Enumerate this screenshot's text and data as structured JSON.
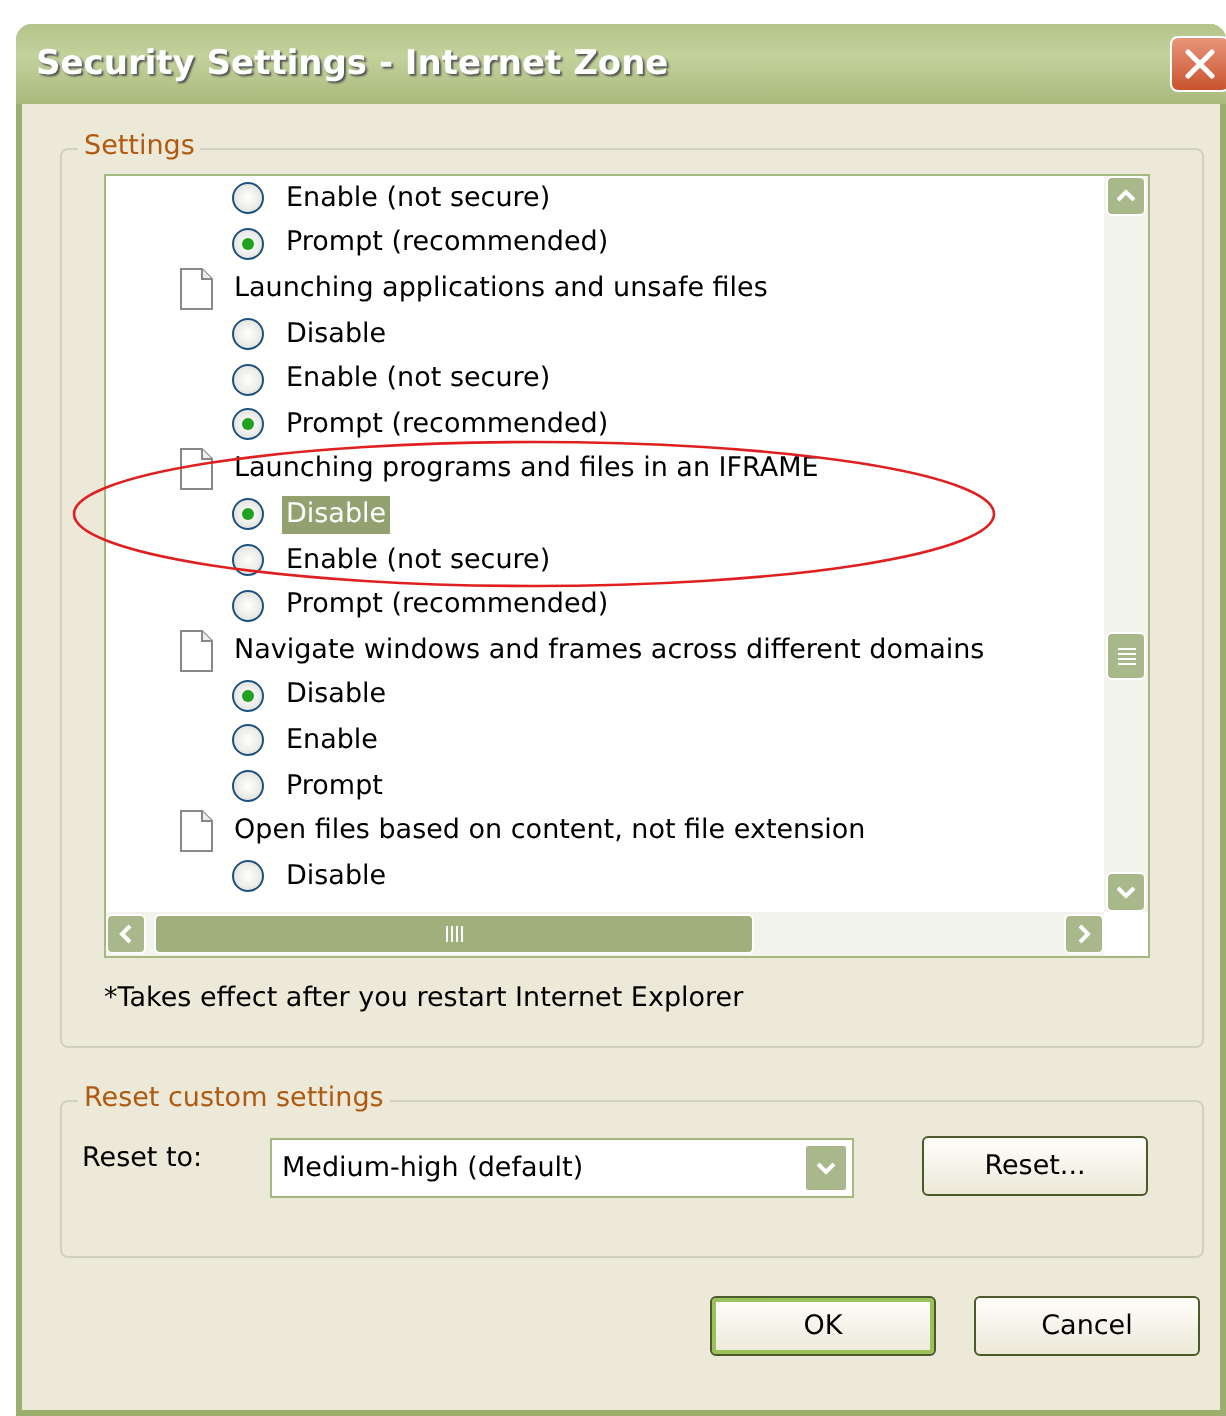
{
  "window": {
    "title": "Security Settings - Internet Zone"
  },
  "settings": {
    "legend": "Settings",
    "items": [
      {
        "kind": "option",
        "label": "Enable (not secure)",
        "selected": false,
        "highlighted": false
      },
      {
        "kind": "option",
        "label": "Prompt (recommended)",
        "selected": true,
        "highlighted": false
      },
      {
        "kind": "category",
        "label": "Launching applications and unsafe files",
        "children": [
          {
            "kind": "option",
            "label": "Disable",
            "selected": false,
            "highlighted": false
          },
          {
            "kind": "option",
            "label": "Enable (not secure)",
            "selected": false,
            "highlighted": false
          },
          {
            "kind": "option",
            "label": "Prompt (recommended)",
            "selected": true,
            "highlighted": false
          }
        ]
      },
      {
        "kind": "category",
        "label": "Launching programs and files in an IFRAME",
        "children": [
          {
            "kind": "option",
            "label": "Disable",
            "selected": true,
            "highlighted": true
          },
          {
            "kind": "option",
            "label": "Enable (not secure)",
            "selected": false,
            "highlighted": false
          },
          {
            "kind": "option",
            "label": "Prompt (recommended)",
            "selected": false,
            "highlighted": false
          }
        ]
      },
      {
        "kind": "category",
        "label": "Navigate windows and frames across different domains",
        "children": [
          {
            "kind": "option",
            "label": "Disable",
            "selected": true,
            "highlighted": false
          },
          {
            "kind": "option",
            "label": "Enable",
            "selected": false,
            "highlighted": false
          },
          {
            "kind": "option",
            "label": "Prompt",
            "selected": false,
            "highlighted": false
          }
        ]
      },
      {
        "kind": "category",
        "label": "Open files based on content, not file extension",
        "children": [
          {
            "kind": "option",
            "label": "Disable",
            "selected": false,
            "highlighted": false
          }
        ]
      }
    ],
    "note": "*Takes effect after you restart Internet Explorer"
  },
  "reset": {
    "legend": "Reset custom settings",
    "label": "Reset to:",
    "value": "Medium-high (default)",
    "button": "Reset..."
  },
  "buttons": [
    {
      "label": "OK",
      "default": true
    },
    {
      "label": "Cancel",
      "default": false
    }
  ]
}
